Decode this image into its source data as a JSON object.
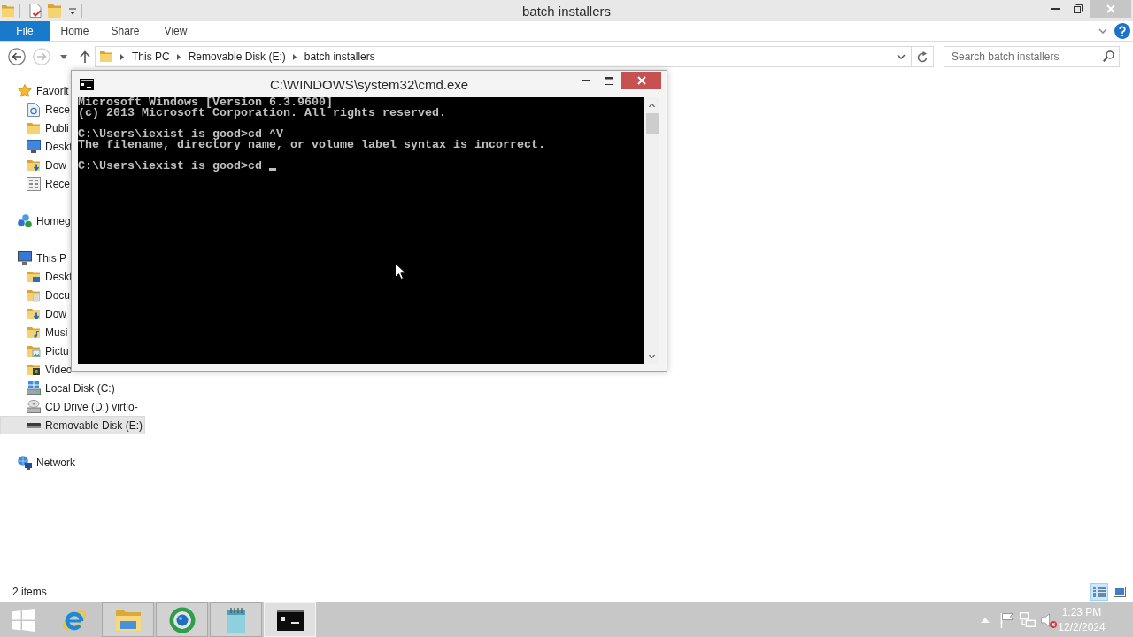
{
  "explorer": {
    "title": "batch installers",
    "ribbon_tabs": [
      {
        "label": "File",
        "kind": "file"
      },
      {
        "label": "Home",
        "kind": "tab"
      },
      {
        "label": "Share",
        "kind": "tab"
      },
      {
        "label": "View",
        "kind": "tab"
      }
    ],
    "nav_buttons": [
      {
        "kind": "back",
        "disabled": false
      },
      {
        "kind": "forward",
        "disabled": true
      }
    ],
    "address": {
      "path": [
        "This PC",
        "Removable Disk (E:)",
        "batch installers"
      ]
    },
    "search": {
      "placeholder": "Search batch installers"
    },
    "nav_pane": [
      {
        "label": "Favorit",
        "kind": "favorites",
        "selected": false,
        "children": [
          {
            "label": "Rece",
            "kind": "recent",
            "selected": false
          },
          {
            "label": "Publi",
            "kind": "folder",
            "selected": false
          },
          {
            "label": "Deskt",
            "kind": "desktop",
            "selected": false
          },
          {
            "label": "Dow",
            "kind": "downloads",
            "selected": false
          },
          {
            "label": "Rece",
            "kind": "recent-places",
            "selected": false
          }
        ]
      },
      {
        "label": "Homeg",
        "kind": "homegroup",
        "selected": false
      },
      {
        "label": "This P",
        "kind": "computer",
        "selected": false,
        "children": [
          {
            "label": "Deskt",
            "kind": "desktop-folder",
            "selected": false
          },
          {
            "label": "Docu",
            "kind": "documents",
            "selected": false
          },
          {
            "label": "Dow",
            "kind": "downloads",
            "selected": false
          },
          {
            "label": "Musi",
            "kind": "music",
            "selected": false
          },
          {
            "label": "Pictu",
            "kind": "pictures",
            "selected": false
          },
          {
            "label": "Video",
            "kind": "videos",
            "selected": false
          },
          {
            "label": "Local Disk (C:)",
            "kind": "local-disk",
            "selected": false
          },
          {
            "label": "CD Drive (D:) virtio-",
            "kind": "cd-drive",
            "selected": false
          },
          {
            "label": "Removable Disk (E:)",
            "kind": "removable-disk",
            "selected": true
          }
        ]
      },
      {
        "label": "Network",
        "kind": "network",
        "selected": false
      }
    ],
    "status_bar": {
      "item_count": "2 items",
      "views": [
        {
          "kind": "details",
          "selected": true
        },
        {
          "kind": "large-icons",
          "selected": false
        }
      ]
    }
  },
  "cmd_window": {
    "title": "C:\\WINDOWS\\system32\\cmd.exe",
    "output": [
      [
        "Microsoft Windows [Version 6.3.9600]",
        "(c) 2013 Microsoft Corporation. All rights reserved."
      ],
      [
        "C:\\Users\\iexist is good>cd ^V",
        "The filename, directory name, or volume label syntax is incorrect."
      ],
      [
        "C:\\Users\\iexist is good>cd"
      ]
    ],
    "cursor_visible": true
  },
  "taskbar": {
    "apps": [
      {
        "kind": "letter-e",
        "running": false,
        "active": false
      },
      {
        "kind": "folder",
        "running": true,
        "active": false
      },
      {
        "kind": "sphere",
        "running": true,
        "active": false
      },
      {
        "kind": "notepad",
        "running": true,
        "active": false
      },
      {
        "kind": "console",
        "running": true,
        "active": true
      }
    ],
    "tray": {
      "volume_muted": true,
      "time": "1:23 PM",
      "date": "12/2/2024"
    }
  }
}
